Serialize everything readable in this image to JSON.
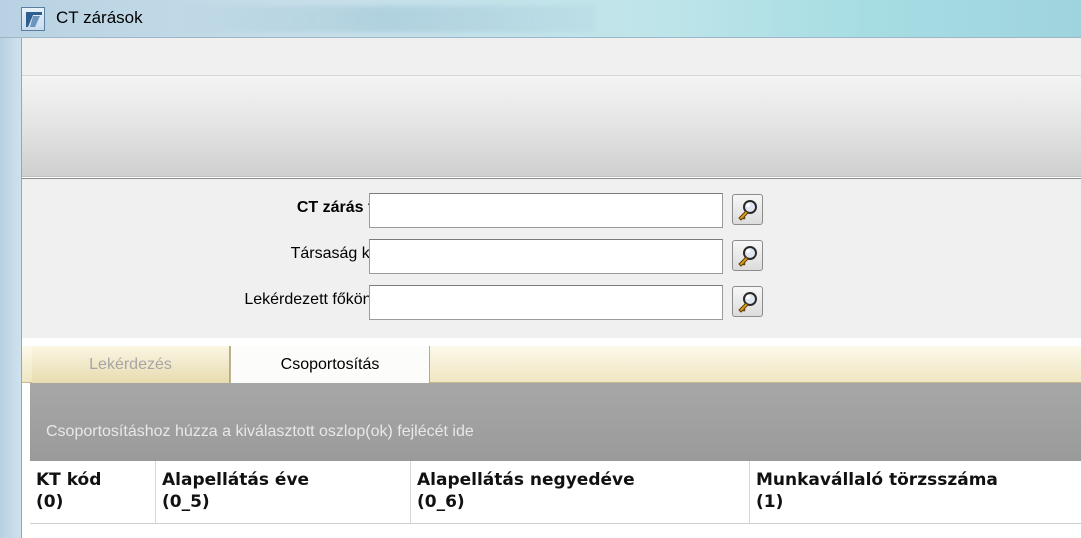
{
  "window": {
    "title": "CT zárások"
  },
  "filters": [
    {
      "label": "CT zárás fej:",
      "value": "",
      "bold": true
    },
    {
      "label": "Társaság kód:",
      "value": "",
      "bold": false
    },
    {
      "label": "Lekérdezett főkönyv:",
      "value": "",
      "bold": false
    }
  ],
  "tabs": {
    "query": "Lekérdezés",
    "grouping": "Csoportosítás",
    "active": "Csoportosítás"
  },
  "groupby": {
    "hint": "Csoportosításhoz húzza a kiválasztott oszlop(ok) fejlécét ide"
  },
  "grid": {
    "columns": [
      {
        "title": "KT kód",
        "sub": "(0)"
      },
      {
        "title": "Alapellátás éve",
        "sub": "(0_5)"
      },
      {
        "title": "Alapellátás negyedéve",
        "sub": "(0_6)"
      },
      {
        "title": "Munkavállaló törzsszáma",
        "sub": "(1)"
      }
    ]
  },
  "icons": {
    "app": "app-window-icon",
    "lookup": "magnifier-key-icon"
  }
}
